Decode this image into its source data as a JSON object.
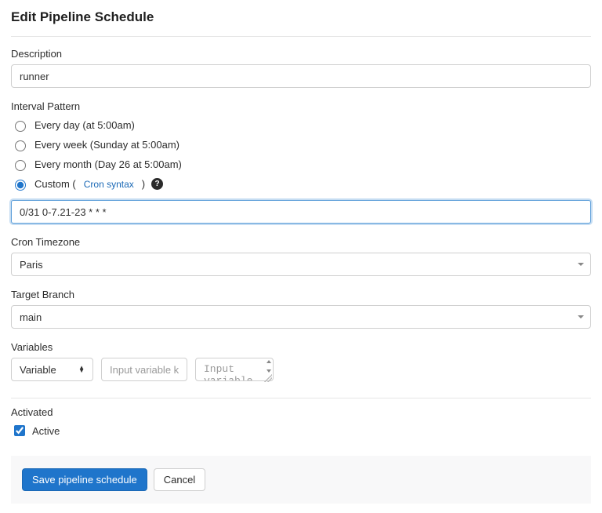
{
  "page": {
    "title": "Edit Pipeline Schedule"
  },
  "description": {
    "label": "Description",
    "value": "runner"
  },
  "interval": {
    "label": "Interval Pattern",
    "options": {
      "daily": {
        "label": "Every day (at 5:00am)"
      },
      "weekly": {
        "label": "Every week (Sunday at 5:00am)"
      },
      "monthly": {
        "label": "Every month (Day 26 at 5:00am)"
      },
      "custom": {
        "prefix": "Custom ( ",
        "link": "Cron syntax",
        "suffix": " )"
      }
    },
    "selected": "custom",
    "cron_value": "0/31 0-7.21-23 * * *"
  },
  "timezone": {
    "label": "Cron Timezone",
    "value": "Paris"
  },
  "branch": {
    "label": "Target Branch",
    "value": "main"
  },
  "variables": {
    "label": "Variables",
    "type_label": "Variable",
    "key_placeholder": "Input variable key",
    "value_placeholder": "Input variable"
  },
  "activated": {
    "label": "Activated",
    "checkbox_label": "Active",
    "checked": true
  },
  "footer": {
    "save": "Save pipeline schedule",
    "cancel": "Cancel"
  }
}
